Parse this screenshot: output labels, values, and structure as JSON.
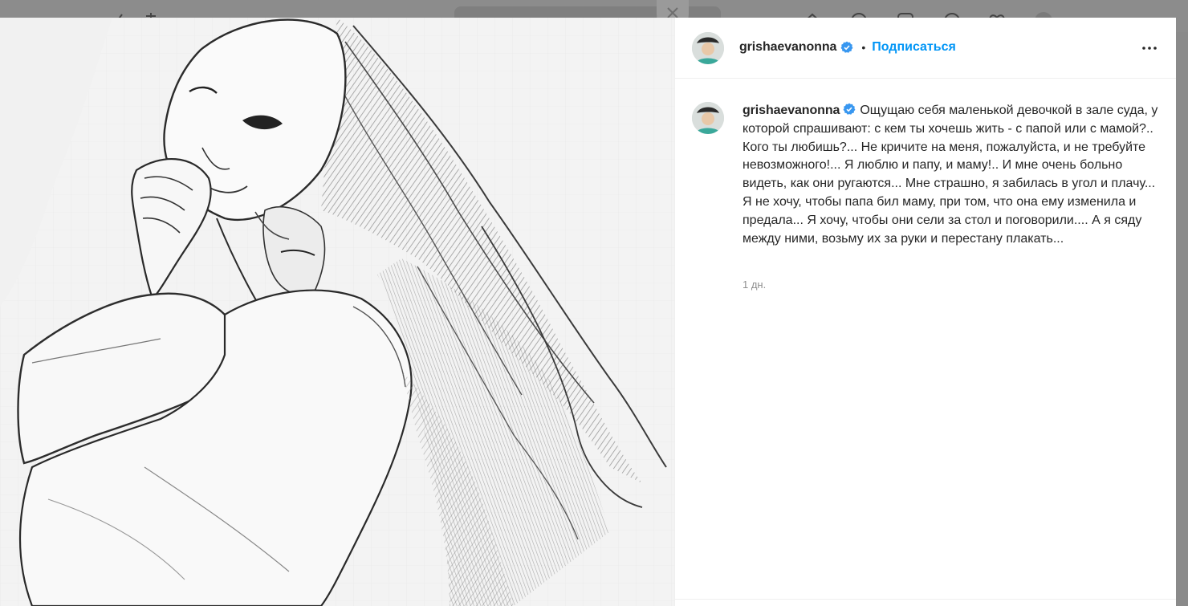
{
  "post": {
    "username": "grishaevanonna",
    "follow_label": "Подписаться",
    "separator": "•",
    "caption": "Ощущаю себя маленькой девочкой в зале суда, у которой спрашивают: с кем ты хочешь жить - с папой или с мамой?.. Кого ты любишь?... Не кричите на меня, пожалуйста, и не требуйте невозможного!... Я люблю и папу, и маму!.. И мне очень больно видеть, как они ругаются... Мне страшно, я забилась в угол и плачу... Я не хочу, чтобы папа бил маму, при том, что она ему изменила и предала... Я хочу, чтобы они сели за стол и поговорили.... А я сяду между ними, возьму их за руки и перестану плакать...",
    "timestamp": "1 дн.",
    "verified": true
  },
  "icons": {
    "verified": "verified-badge-icon",
    "more": "more-options-icon",
    "close": "close-icon"
  },
  "colors": {
    "link": "#0095f6",
    "text": "#262626",
    "muted": "#8e8e8e",
    "verified": "#3897f0"
  }
}
